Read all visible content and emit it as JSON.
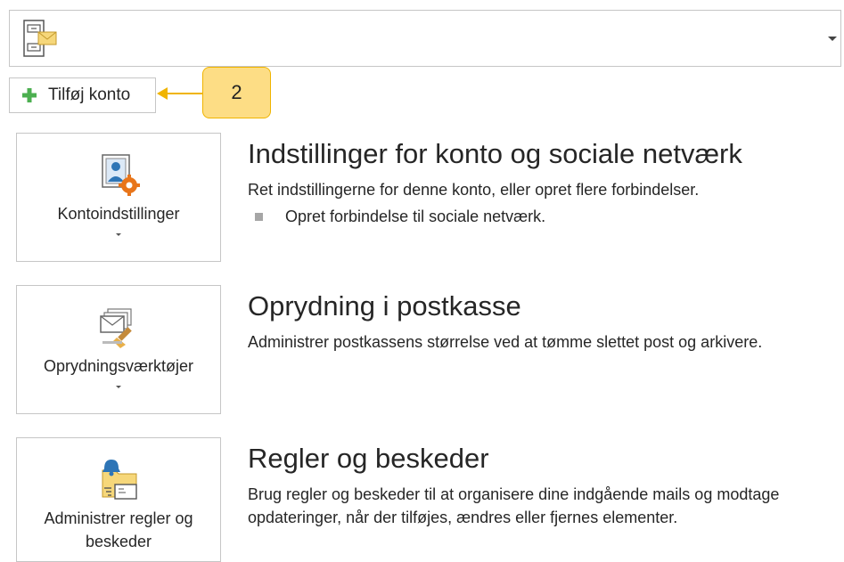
{
  "account_selector": {
    "icon": "account-mailbox-icon"
  },
  "add_account": {
    "label": "Tilføj konto",
    "icon": "plus-icon"
  },
  "callout": {
    "number": "2",
    "color": "#fddd85"
  },
  "sections": [
    {
      "tile_label": "Kontoindstillinger",
      "tile_icon": "account-settings-icon",
      "title": "Indstillinger for konto og sociale netværk",
      "description": "Ret indstillingerne for denne konto, eller opret flere forbindelser.",
      "bullet": "Opret forbindelse til sociale netværk."
    },
    {
      "tile_label": "Oprydningsværktøjer",
      "tile_icon": "cleanup-tools-icon",
      "title": "Oprydning i postkasse",
      "description": "Administrer postkassens størrelse ved at tømme slettet post og arkivere."
    },
    {
      "tile_label": "Administrer regler og beskeder",
      "tile_icon": "rules-alerts-icon",
      "title": "Regler og beskeder",
      "description": "Brug regler og beskeder til at organisere dine indgående mails og modtage opdateringer, når der tilføjes, ændres eller fjernes elementer."
    }
  ],
  "colors": {
    "accent_orange": "#e8751a",
    "accent_blue": "#2e75b6",
    "plus_green": "#4caf50",
    "callout_border": "#f0b400"
  }
}
